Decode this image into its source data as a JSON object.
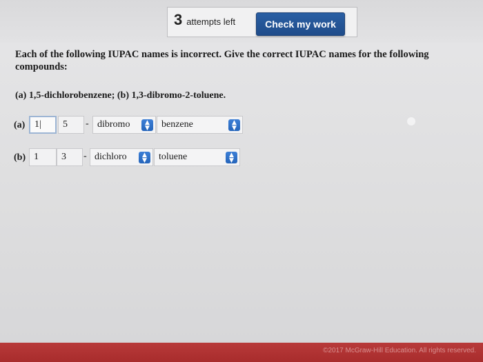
{
  "header": {
    "attempts_count": "3",
    "attempts_label": "attempts left",
    "check_button_label": "Check my work"
  },
  "question": {
    "prompt": "Each of the following IUPAC names is incorrect. Give the correct IUPAC names for the following compounds:",
    "parts": "(a) 1,5-dichlorobenzene; (b) 1,3-dibromo-2-toluene."
  },
  "answer_a": {
    "label": "(a)",
    "locant_1": "1|",
    "comma": ",",
    "locant_2": "5",
    "dash": "-",
    "prefix_selected": "dibromo",
    "parent_selected": "benzene"
  },
  "answer_b": {
    "label": "(b)",
    "locant_1": "1",
    "comma": ",",
    "locant_2": "3",
    "dash": "-",
    "prefix_selected": "dichloro",
    "parent_selected": "toluene"
  },
  "footer": {
    "copyright": "©2017 McGraw-Hill Education. All rights reserved."
  },
  "colors": {
    "button_blue": "#1f4c8a",
    "select_chevron_blue": "#2565bb",
    "footer_red": "#a82c2c"
  },
  "icons": {
    "select_arrow": "chevron-up-down-icon"
  }
}
